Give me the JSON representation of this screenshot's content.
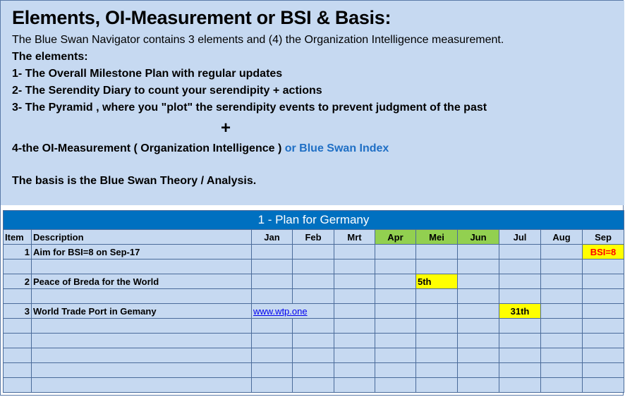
{
  "intro": {
    "title": "Elements, OI-Measurement or BSI & Basis:",
    "description": "The Blue Swan Navigator contains 3 elements and (4) the Organization Intelligence measurement.",
    "elements_heading": "The elements:",
    "element_1": "1- The Overall Milestone Plan with regular updates",
    "element_2": "2- The Serendity Diary to count your serendipity + actions",
    "element_3": "3- The Pyramid , where you \"plot\" the serendipity events to prevent judgment of the past",
    "plus": "+",
    "element_4_prefix": "4-the OI-Measurement ( Organization Intelligence )",
    "element_4_link": "or Blue Swan Index",
    "basis": "The basis is the Blue Swan Theory / Analysis."
  },
  "plan": {
    "title": "1 - Plan for Germany",
    "headers": {
      "item": "Item",
      "description": "Description",
      "months": [
        "Jan",
        "Feb",
        "Mrt",
        "Apr",
        "Mei",
        "Jun",
        "Jul",
        "Aug",
        "Sep"
      ]
    },
    "rows": [
      {
        "item": "1",
        "description": "Aim for BSI=8 on Sep-17",
        "sep": "BSI=8"
      },
      {
        "item": "2",
        "description": "Peace of Breda for the World",
        "mei": "5th"
      },
      {
        "item": "3",
        "description": "World Trade Port in Gemany",
        "jan_link": "www.wtp.one",
        "jul": "31th"
      }
    ]
  },
  "colors": {
    "intro_bg": "#c6d9f1",
    "title_bar": "#0070c0",
    "green_header": "#92d050",
    "yellow_highlight": "#ffff00",
    "red_text": "#ff0000",
    "blue_link": "#1f6fc5"
  }
}
